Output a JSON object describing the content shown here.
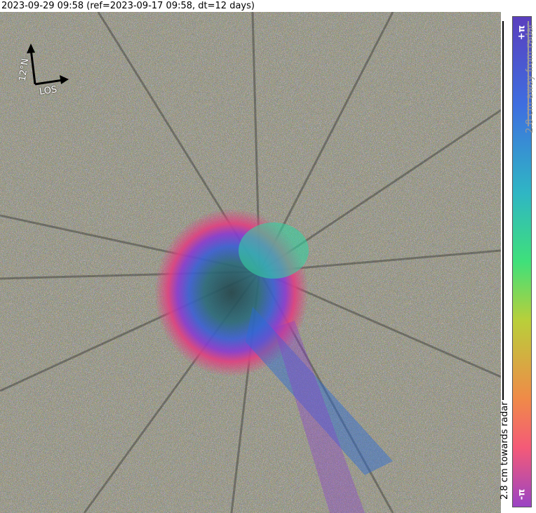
{
  "header": {
    "title": "2023-09-29 09:58 (ref=2023-09-17 09:58, dt=12 days)"
  },
  "north_arrow": {
    "angle_label": "12°N",
    "los_label": "LOS"
  },
  "colorbar": {
    "top_label": "+π",
    "bottom_label": "-π",
    "away_label": "2.8 cm away from radar",
    "towards_label": "2.8 cm towards radar",
    "colors": [
      "#5a3fbe",
      "#3e6ee0",
      "#2fb6c4",
      "#3fe07a",
      "#b9cf3a",
      "#f08a48",
      "#f45a78",
      "#9a44c4"
    ]
  }
}
